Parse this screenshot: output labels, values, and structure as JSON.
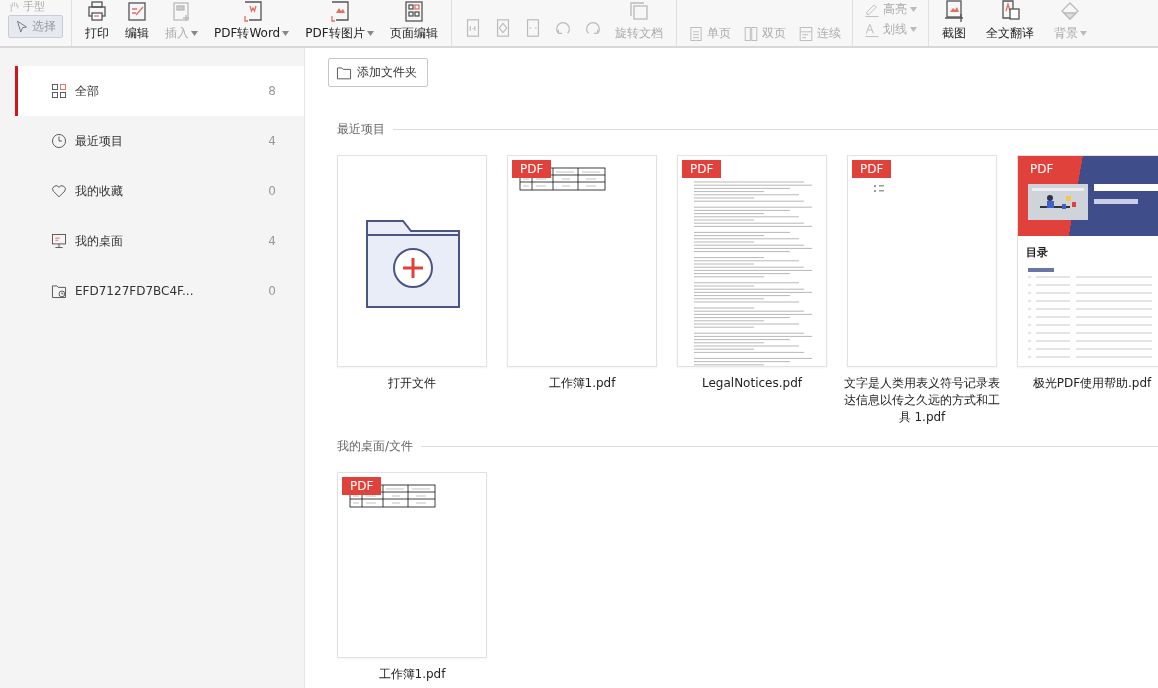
{
  "toolbar": {
    "hand_tool": {
      "label": "手型",
      "disabled": true
    },
    "select_tool": {
      "label": "选择",
      "selected": true
    },
    "main_buttons": [
      {
        "label": "打印",
        "disabled": false,
        "dropdown": false
      },
      {
        "label": "编辑",
        "disabled": false,
        "dropdown": false
      },
      {
        "label": "插入",
        "disabled": true,
        "dropdown": true
      },
      {
        "label": "PDF转Word",
        "disabled": false,
        "dropdown": true
      },
      {
        "label": "PDF转图片",
        "disabled": false,
        "dropdown": true
      },
      {
        "label": "页面编辑",
        "disabled": false,
        "dropdown": false
      }
    ],
    "rotate_button": {
      "label": "旋转文档",
      "disabled": true
    },
    "view_modes": [
      {
        "label": "单页",
        "disabled": true
      },
      {
        "label": "双页",
        "disabled": true
      },
      {
        "label": "连续",
        "disabled": true
      }
    ],
    "markup": [
      {
        "label": "高亮",
        "disabled": true,
        "dropdown": true
      },
      {
        "label": "划线",
        "disabled": true,
        "dropdown": true
      }
    ],
    "tools": [
      {
        "label": "截图",
        "disabled": false,
        "dropdown": false
      },
      {
        "label": "全文翻译",
        "disabled": false,
        "dropdown": false
      },
      {
        "label": "背景",
        "disabled": true,
        "dropdown": true
      }
    ]
  },
  "sidebar": {
    "items": [
      {
        "label": "全部",
        "count": "8",
        "selected": true
      },
      {
        "label": "最近项目",
        "count": "4",
        "selected": false
      },
      {
        "label": "我的收藏",
        "count": "0",
        "selected": false
      },
      {
        "label": "我的桌面",
        "count": "4",
        "selected": false
      },
      {
        "label": "EFD7127FD7BC4F...",
        "count": "0",
        "selected": false
      }
    ]
  },
  "add_folder_button": {
    "label": "添加文件夹"
  },
  "sections": [
    {
      "title": "最近项目",
      "files": [
        {
          "kind": "new",
          "name": "打开文件"
        },
        {
          "kind": "table",
          "badge": "PDF",
          "name": "工作簿1.pdf"
        },
        {
          "kind": "text",
          "badge": "PDF",
          "name": "LegalNotices.pdf"
        },
        {
          "kind": "bullets",
          "badge": "PDF",
          "name": "文字是人类用表义符号记录表达信息以传之久远的方式和工具 1.pdf"
        },
        {
          "kind": "guide",
          "badge": "PDF",
          "name": "极光PDF使用帮助.pdf",
          "preview": {
            "heading": "目录"
          }
        }
      ]
    },
    {
      "title": "我的桌面/文件",
      "files": [
        {
          "kind": "table",
          "badge": "PDF",
          "name": "工作簿1.pdf"
        }
      ]
    }
  ]
}
